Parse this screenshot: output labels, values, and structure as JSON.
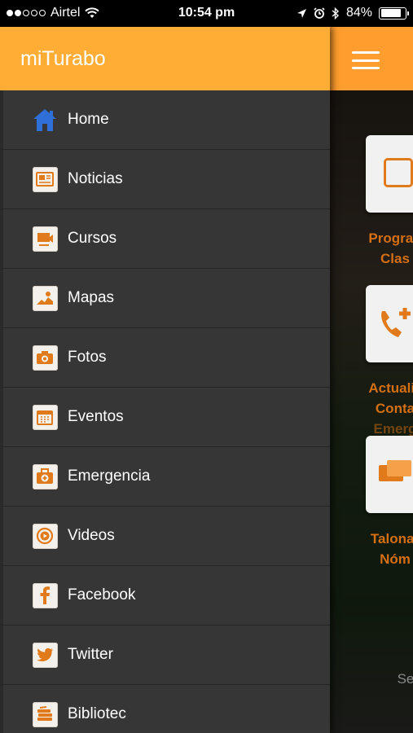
{
  "status_bar": {
    "carrier": "Airtel",
    "time": "10:54 pm",
    "battery": "84%",
    "battery_level": 0.84
  },
  "app": {
    "title": "miTurabo"
  },
  "menu": {
    "items": [
      {
        "label": "Home",
        "icon": "home-icon"
      },
      {
        "label": "Noticias",
        "icon": "news-icon"
      },
      {
        "label": "Cursos",
        "icon": "courses-icon"
      },
      {
        "label": "Mapas",
        "icon": "map-icon"
      },
      {
        "label": "Fotos",
        "icon": "camera-icon"
      },
      {
        "label": "Eventos",
        "icon": "calendar-icon"
      },
      {
        "label": "Emergencia",
        "icon": "first-aid-icon"
      },
      {
        "label": "Videos",
        "icon": "play-icon"
      },
      {
        "label": "Facebook",
        "icon": "facebook-icon"
      },
      {
        "label": "Twitter",
        "icon": "twitter-icon"
      },
      {
        "label": "Bibliotec",
        "icon": "library-icon"
      }
    ]
  },
  "background": {
    "tiles": [
      {
        "label_line1": "Progran",
        "label_line2": "Clas"
      },
      {
        "label_line1": "Actualiz",
        "label_line2": "Conta",
        "label_line3": "Emerg"
      },
      {
        "label_line1": "Talonar",
        "label_line2": "Nóm"
      }
    ],
    "partial_text": "Se"
  },
  "colors": {
    "accent": "#ffad35",
    "icon_orange": "#e07a1a",
    "drawer_bg": "#363636",
    "home_blue": "#2f6fd8"
  }
}
